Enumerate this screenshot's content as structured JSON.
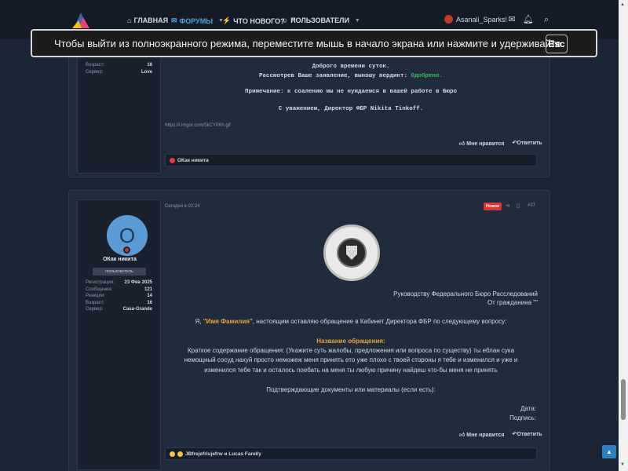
{
  "nav": {
    "items": [
      {
        "label": "ГЛАВНАЯ",
        "icon": "home-icon",
        "glyph": "⌂"
      },
      {
        "label": "ФОРУМЫ",
        "icon": "forums-icon",
        "glyph": "✉",
        "dropdown": true,
        "active": true
      },
      {
        "label": "ЧТО НОВОГО?",
        "icon": "whats-new-icon",
        "glyph": "⚡",
        "dropdown": true
      },
      {
        "label": "ПОЛЬЗОВАТЕЛИ",
        "icon": "users-icon",
        "glyph": "☺",
        "dropdown": true
      }
    ],
    "username": "Asanali_Sparks!",
    "accent": "#4aa3e0"
  },
  "toast": {
    "text": "Чтобы выйти из полноэкранного режима, переместите мышь в начало экрана или нажмите и удерживайте",
    "key": "Esc"
  },
  "post1": {
    "stats": [
      {
        "k": "Возраст:",
        "v": "18"
      },
      {
        "k": "Сервер:",
        "v": "Love"
      }
    ],
    "greeting": "Доброго времени суток.",
    "verdict_prefix": "Рассмотрев Ваше заявление, выношу вердикт:",
    "verdict": "Одобрено.",
    "note": "Примечание: к соалению мы не нуждаемся в вашей работе в Бюро",
    "signature": "С уважением, Директор ФБР Nikita Tinkoff.",
    "link": "https://i.imgur.com/5kCY0Kh.gif",
    "like": "Мне нравится",
    "reply": "Ответить",
    "reactions": "ОКак никита"
  },
  "post2": {
    "avatar_letter": "O",
    "username": "ОКак никита",
    "role": "ПОЛЬЗОВАТЕЛЬ",
    "stats": [
      {
        "k": "Регистрация:",
        "v": "23 Фев 2025"
      },
      {
        "k": "Сообщения:",
        "v": "121"
      },
      {
        "k": "Реакции:",
        "v": "14"
      },
      {
        "k": "Возраст:",
        "v": "16"
      },
      {
        "k": "Сервер:",
        "v": "Casa-Grande"
      }
    ],
    "date": "Сегодня в 02:24",
    "badge": "Новое",
    "number": "#37",
    "to_line1": "Руководству Федерального Бюро Расследований",
    "to_line2": "От гражданина \"\"",
    "intro_pre": "Я,",
    "intro_name": "\"Имя Фамилия\"",
    "intro_post": ", настоящим оставляю обращение в Кабинет Директора ФБР по следующему вопросу:",
    "heading": "Название обращения:",
    "body1": "Краткое содержание обращения: (Укажите суть жалобы, предложения или вопроса по существу) ты еблан сука",
    "body2": "немощный сосуд нахуй просто неможеж меня принять ето уже плохо с твоей стороны я тебе и изменился и уже и",
    "body3": "изменился тебе так и осталось поебать на меня ты любую причину найдеш что-бы меня не принять",
    "docs": "Подтверждающие документы или материалы (если есть):",
    "date_label": "Дата:",
    "sign_label": "Подпись:",
    "like": "Мне нравится",
    "reply": "Ответить",
    "reactions": "JBfrejefriujefrw и Lucas Farelly"
  },
  "colors": {
    "approved": "#3bb86b",
    "gold": "#e8a23a",
    "badge": "#dd3333"
  }
}
